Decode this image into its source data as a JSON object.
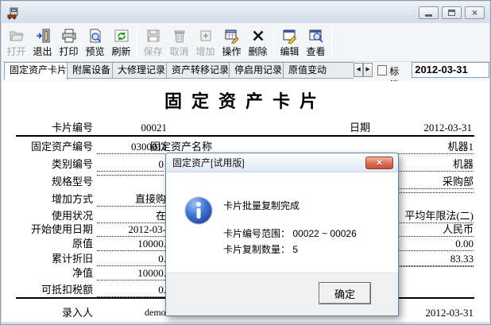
{
  "toolbar": {
    "items": [
      {
        "label": "打开",
        "icon": "open-folder",
        "enabled": false
      },
      {
        "label": "退出",
        "icon": "exit-door",
        "enabled": true
      },
      {
        "label": "打印",
        "icon": "printer",
        "enabled": true
      },
      {
        "label": "预览",
        "icon": "preview-page",
        "enabled": true
      },
      {
        "label": "刷新",
        "icon": "refresh",
        "enabled": true
      },
      {
        "label": "保存",
        "icon": "save-floppy",
        "enabled": false
      },
      {
        "label": "取消",
        "icon": "cancel-trash",
        "enabled": false
      },
      {
        "label": "增加",
        "icon": "add-plus",
        "enabled": false
      },
      {
        "label": "操作",
        "icon": "operate-table",
        "enabled": true
      },
      {
        "label": "删除",
        "icon": "delete-x",
        "enabled": true
      },
      {
        "label": "编辑",
        "icon": "edit-pencil",
        "enabled": true
      },
      {
        "label": "查看",
        "icon": "view-magnifier",
        "enabled": true
      }
    ]
  },
  "tabs": {
    "items": [
      "固定资产卡片",
      "附属设备",
      "大修理记录",
      "资产转移记录",
      "停启用记录",
      "原值变动"
    ],
    "active": "固定资产卡片",
    "label_checkbox": "标签",
    "date_value": "2012-03-31"
  },
  "card": {
    "title": "固定资产卡片",
    "header": {
      "label": "卡片编号",
      "value": "00021",
      "date_label": "日期",
      "date_value": "2012-03-31"
    },
    "name_row": {
      "label": "固定资产编号",
      "value": "0300011",
      "mid_label": "固定资产名称",
      "mid_value": "机器1"
    },
    "rows": [
      {
        "label": "类别编号",
        "value": "0",
        "right": "机器"
      },
      {
        "label": "规格型号",
        "value": "",
        "right": "采购部"
      },
      {
        "label": "增加方式",
        "value": "直接购入",
        "right": ""
      },
      {
        "label": "使用状况",
        "value": "在用",
        "right": "平均年限法(二)"
      },
      {
        "label": "开始使用日期",
        "value": "2012-03-31",
        "right": "人民币"
      },
      {
        "label": "原值",
        "value": "10000.00",
        "right": "0.00"
      },
      {
        "label": "累计折旧",
        "value": "0.00",
        "right": "83.33"
      },
      {
        "label": "净值",
        "value": "10000.00",
        "right": ""
      },
      {
        "label": "可抵扣税额",
        "value": "0.00"
      }
    ],
    "footer": {
      "label": "录入人",
      "value": "demo",
      "right_value": "2012-03-31"
    }
  },
  "dialog": {
    "title": "固定资产[试用版]",
    "message": "卡片批量复制完成",
    "range_label": "卡片编号范围：",
    "range_value": "00022 ~ 00026",
    "count_label": "卡片复制数量：",
    "count_value": "5",
    "ok_label": "确定"
  },
  "colors": {
    "dialog_close": "#d96a52",
    "info_icon_blue": "#2a5bc0",
    "refresh_green": "#1d9b1d",
    "pencil_yellow": "#f7c948"
  }
}
